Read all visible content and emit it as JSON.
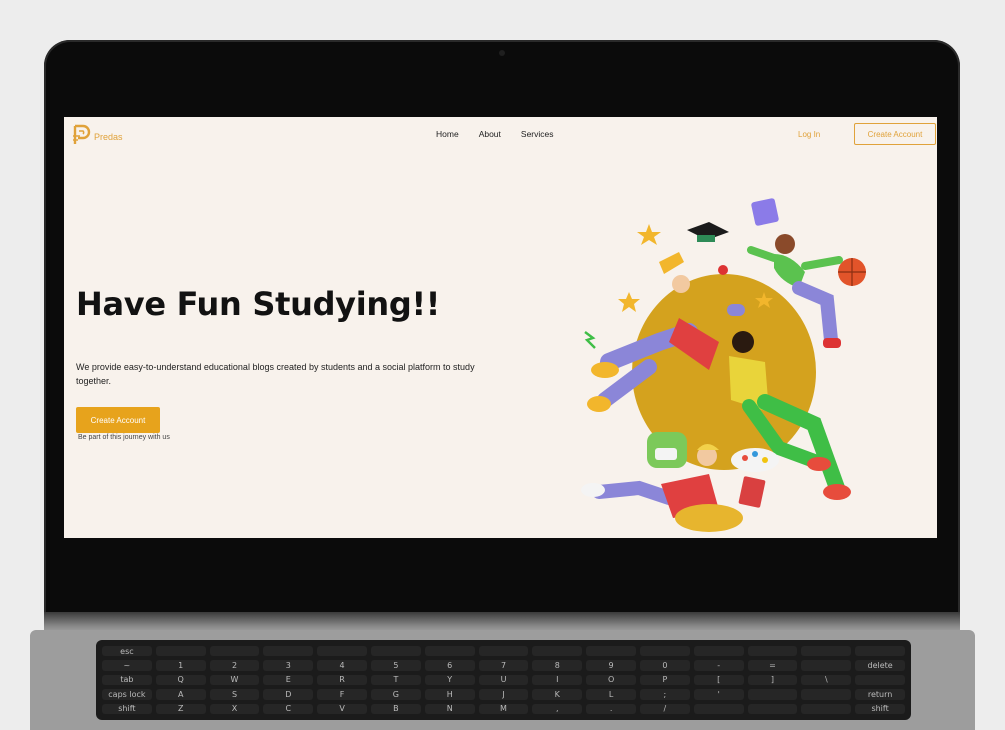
{
  "brand": {
    "name": "Predas",
    "color": "#e0a23a"
  },
  "nav": {
    "links": [
      "Home",
      "About",
      "Services"
    ],
    "login": "Log In",
    "cta": "Create Account"
  },
  "hero": {
    "title": "Have Fun Studying!!",
    "description": "We provide easy-to-understand educational blogs created by students and a social platform to study together.",
    "cta": "Create Account",
    "subtext": "Be part of this journey with us",
    "cta_color": "#e7a31c"
  },
  "keyboard": {
    "keys": [
      "esc",
      "",
      "",
      "",
      "",
      "",
      "",
      "",
      "",
      "",
      "",
      "",
      "",
      "",
      "",
      "~",
      "1",
      "2",
      "3",
      "4",
      "5",
      "6",
      "7",
      "8",
      "9",
      "0",
      "-",
      "=",
      "",
      "delete",
      "tab",
      "Q",
      "W",
      "E",
      "R",
      "T",
      "Y",
      "U",
      "I",
      "O",
      "P",
      "[",
      "]",
      "\\",
      "",
      "caps lock",
      "A",
      "S",
      "D",
      "F",
      "G",
      "H",
      "J",
      "K",
      "L",
      ";",
      "'",
      "",
      "",
      "return",
      "shift",
      "Z",
      "X",
      "C",
      "V",
      "B",
      "N",
      "M",
      ",",
      ".",
      "/",
      "",
      "",
      "",
      "shift"
    ]
  }
}
